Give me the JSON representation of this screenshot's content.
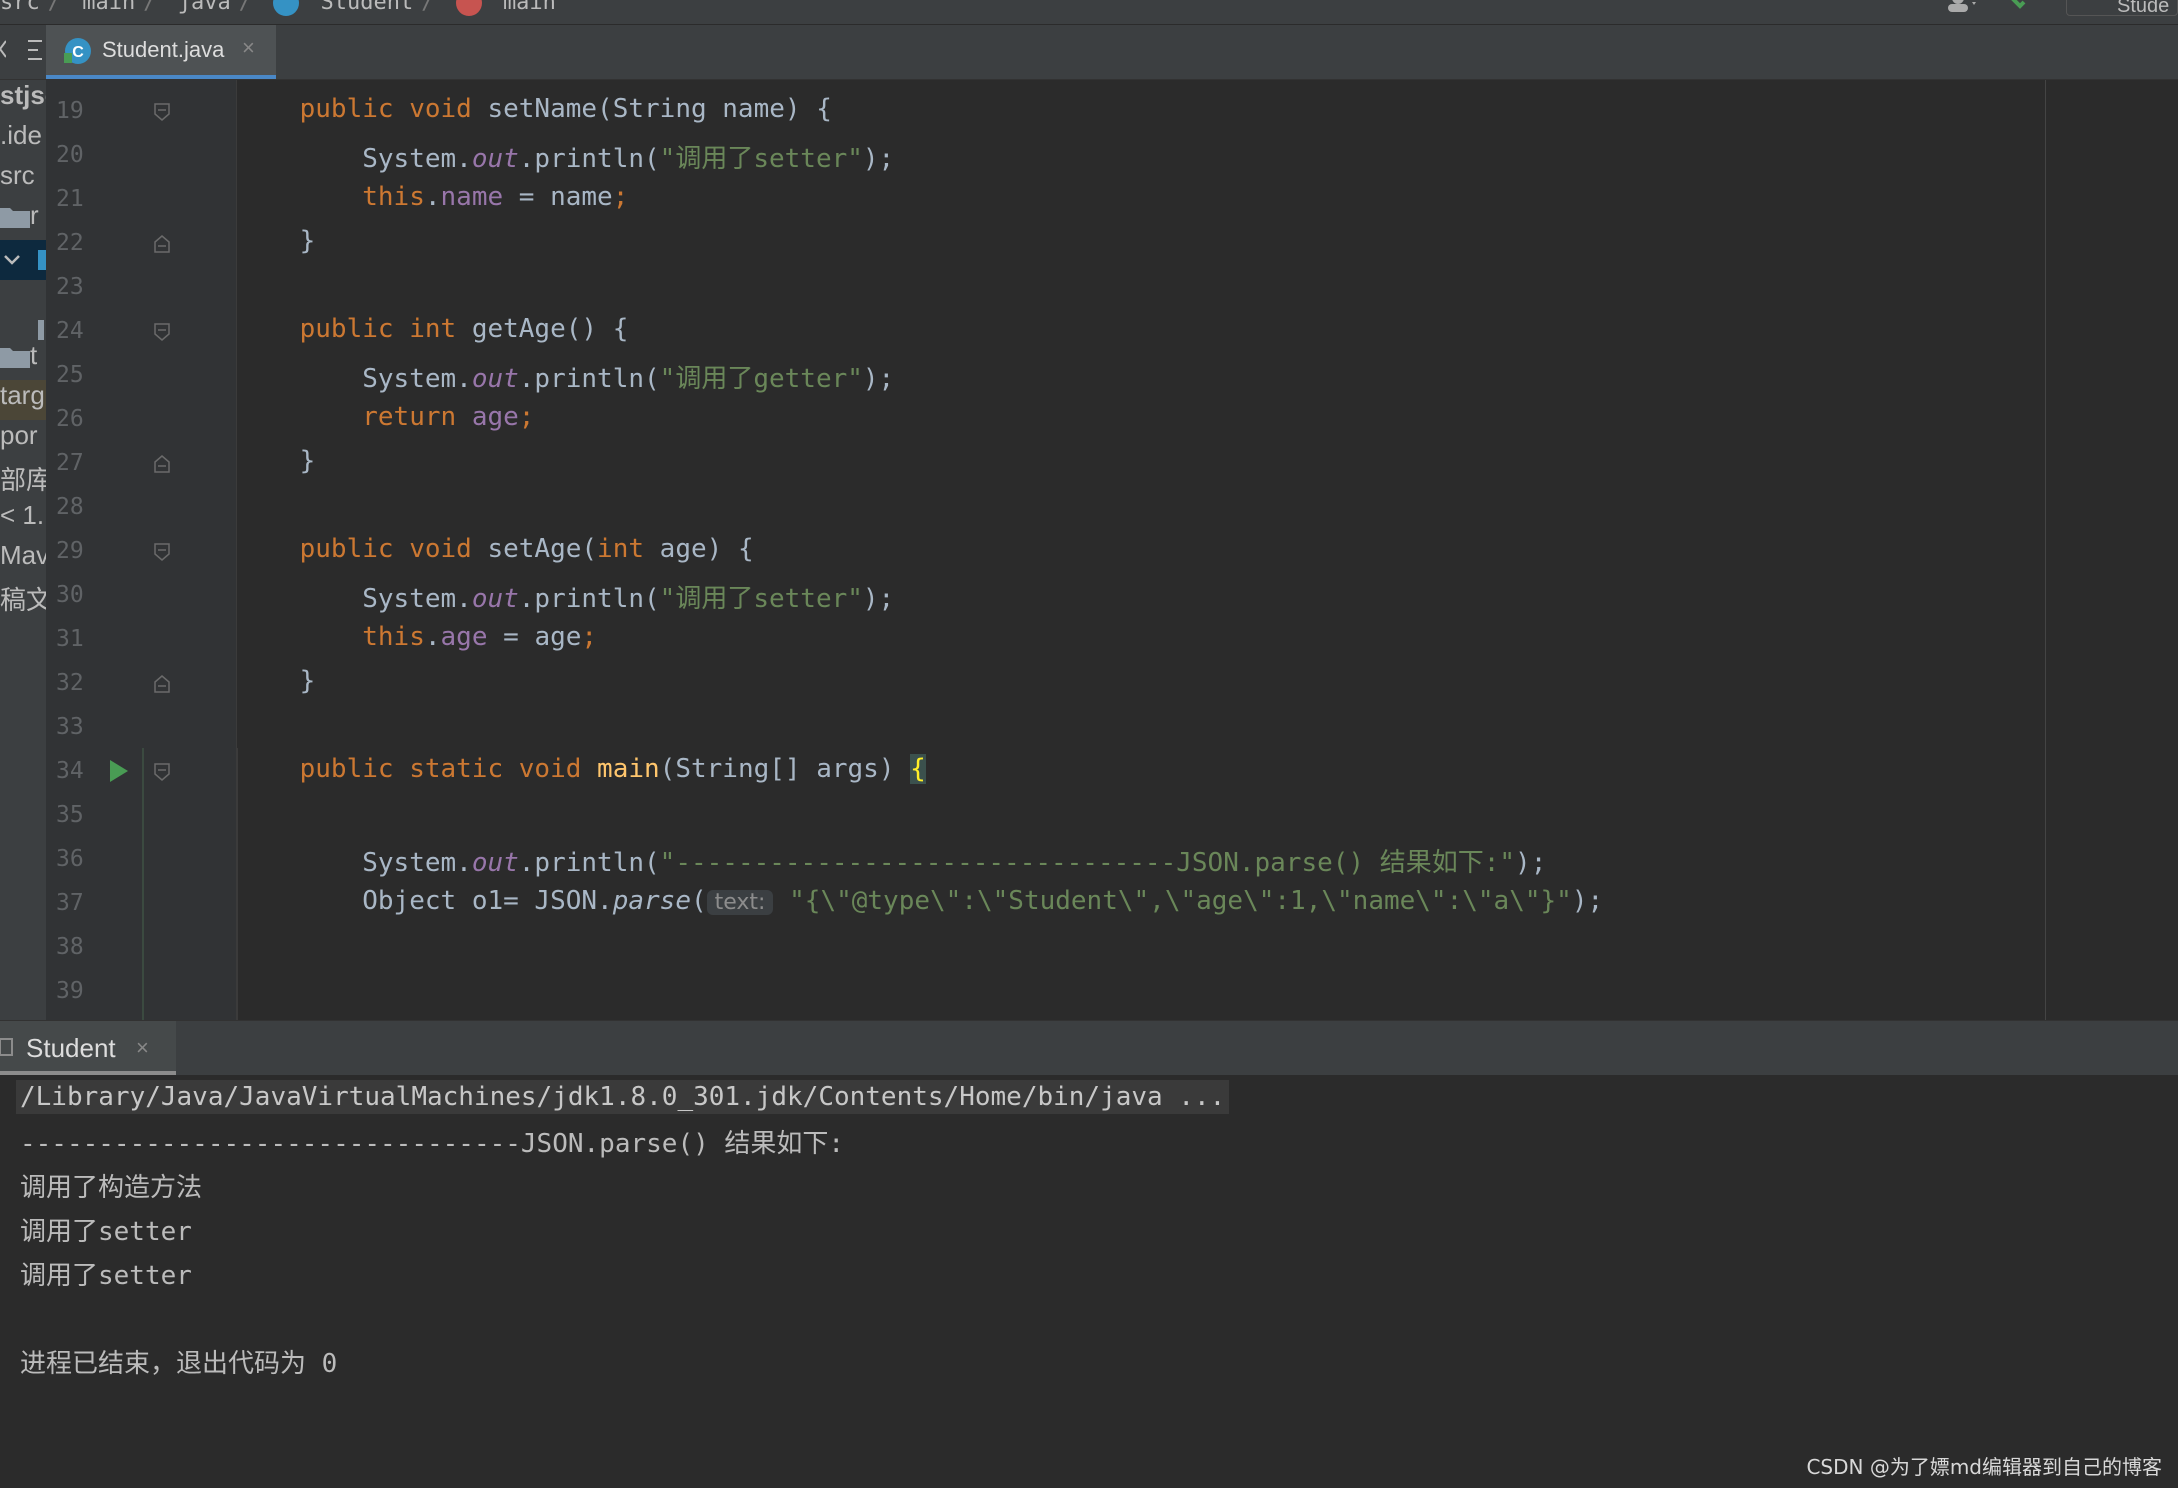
{
  "breadcrumb": {
    "items": [
      "src",
      "main",
      "java",
      "Student",
      "main"
    ],
    "separator": "/",
    "right_box_label": "Stude"
  },
  "editor_tab": {
    "filename": "Student.java",
    "close": "×"
  },
  "sidebar": {
    "items": [
      "stjsc",
      ".ide",
      "src",
      "r",
      "",
      "",
      "t",
      "targ",
      "por",
      "部库",
      "< 1.",
      "Mav",
      "稿文"
    ]
  },
  "code": {
    "line_numbers": [
      "19",
      "20",
      "21",
      "22",
      "23",
      "24",
      "25",
      "26",
      "27",
      "28",
      "29",
      "30",
      "31",
      "32",
      "33",
      "34",
      "35",
      "36",
      "37",
      "38",
      "39"
    ],
    "l19": {
      "a": "public void ",
      "b": "setName",
      "c": "(String name) {"
    },
    "l20": {
      "a": "System.",
      "b": "out",
      "c": ".println(",
      "d": "\"调用了setter\"",
      "e": ");"
    },
    "l21": {
      "a": "this",
      "b": ".",
      "c": "name",
      "d": " = name",
      "e": ";"
    },
    "l22": "}",
    "l24": {
      "a": "public int ",
      "b": "getAge",
      "c": "() {"
    },
    "l25": {
      "a": "System.",
      "b": "out",
      "c": ".println(",
      "d": "\"调用了getter\"",
      "e": ");"
    },
    "l26": {
      "a": "return ",
      "b": "age",
      "c": ";"
    },
    "l27": "}",
    "l29": {
      "a": "public void ",
      "b": "setAge",
      "c": "(",
      "d": "int ",
      "e": "age) {"
    },
    "l30": {
      "a": "System.",
      "b": "out",
      "c": ".println(",
      "d": "\"调用了setter\"",
      "e": ");"
    },
    "l31": {
      "a": "this",
      "b": ".",
      "c": "age",
      "d": " = age",
      "e": ";"
    },
    "l32": "}",
    "l34": {
      "a": "public static void ",
      "b": "main",
      "c": "(String[] args) ",
      "d": "{"
    },
    "l36": {
      "a": "System.",
      "b": "out",
      "c": ".println(",
      "d": "\"--------------------------------JSON.parse() 结果如下:\"",
      "e": ");"
    },
    "l37": {
      "a": "Object ",
      "b": "o1",
      "c": "= JSON.",
      "d": "parse",
      "e": "(",
      "hint": "text:",
      "f": "\"{\\\"@type\\\":\\\"Student\\\",\\\"age\\\":1,\\\"name\\\":\\\"a\\\"}\"",
      "g": ");"
    }
  },
  "run_panel": {
    "tab_label": "Student",
    "close": "×",
    "output": [
      "/Library/Java/JavaVirtualMachines/jdk1.8.0_301.jdk/Contents/Home/bin/java ...",
      "--------------------------------JSON.parse() 结果如下:",
      "调用了构造方法",
      "调用了setter",
      "调用了setter",
      "",
      "进程已结束，退出代码为 0"
    ]
  },
  "watermark": "CSDN @为了嫖md编辑器到自己的博客",
  "colors": {
    "keyword": "#cc7832",
    "string": "#6a8759",
    "method_decl": "#ffc66d",
    "field": "#9876aa",
    "plain": "#a9b7c6",
    "background": "#2b2b2b",
    "tab_accent": "#4a88c7",
    "run_arrow": "#499c54"
  },
  "icons": [
    "java-class-icon",
    "run-arrow-icon",
    "fold-marker-icon",
    "folder-icon",
    "user-icon",
    "hammer-icon",
    "structure-menu-icon"
  ]
}
